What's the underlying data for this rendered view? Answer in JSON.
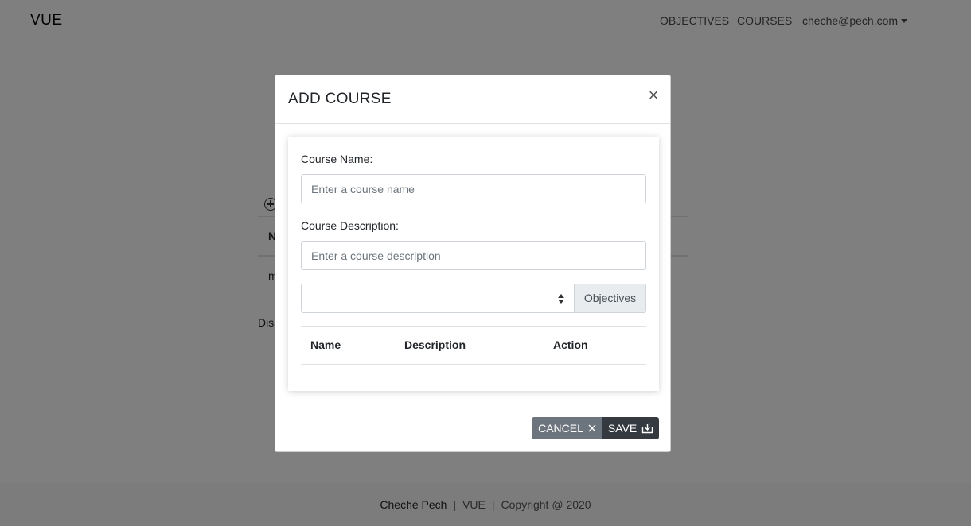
{
  "navbar": {
    "brand": "VUE",
    "links": [
      "OBJECTIVES",
      "COURSES"
    ],
    "user": "cheche@pech.com"
  },
  "background": {
    "table_header_fragment": "N",
    "row_fragment": "m",
    "footer_fragment": "Dis"
  },
  "modal": {
    "title": "ADD COURSE",
    "close_glyph": "×",
    "form": {
      "name_label": "Course Name:",
      "name_placeholder": "Enter a course name",
      "name_value": "",
      "desc_label": "Course Description:",
      "desc_placeholder": "Enter a course description",
      "desc_value": "",
      "select_value": "",
      "objectives_addon": "Objectives"
    },
    "table": {
      "columns": [
        "Name",
        "Description",
        "Action"
      ],
      "rows": []
    },
    "buttons": {
      "cancel_label": "CANCEL",
      "cancel_icon": "x-icon",
      "save_label": "SAVE",
      "save_icon": "download-icon"
    }
  },
  "footer": {
    "author": "Cheché Pech",
    "separator": "|",
    "app": "VUE",
    "copyright": "Copyright @ 2020"
  },
  "colors": {
    "backdrop": "rgba(0,0,0,0.5)",
    "cancel_button": "#6c757d",
    "save_button": "#343a40",
    "addon_bg": "#e9ecef"
  }
}
